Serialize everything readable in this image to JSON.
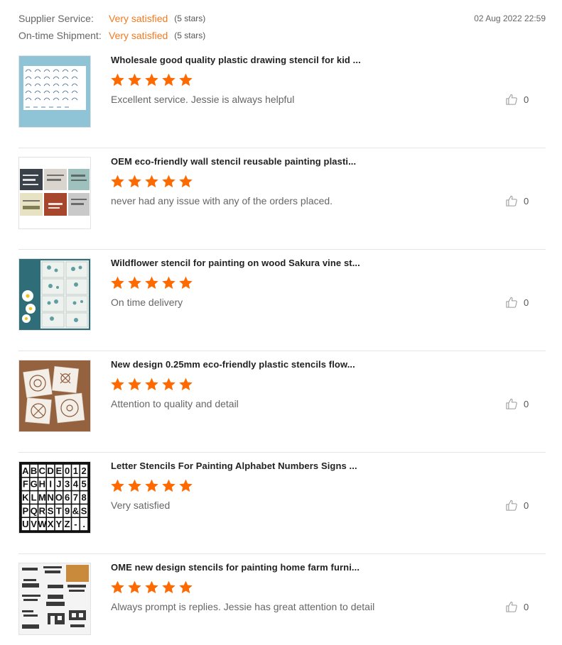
{
  "summary": {
    "supplier_service": {
      "label": "Supplier Service:",
      "value": "Very satisfied",
      "stars_note": "(5 stars)"
    },
    "ontime_shipment": {
      "label": "On-time Shipment:",
      "value": "Very satisfied",
      "stars_note": "(5 stars)"
    },
    "date": "02 Aug 2022 22:59"
  },
  "colors": {
    "accent": "#f47a1f",
    "star": "#ff6a00"
  },
  "icons": {
    "star": "star-icon",
    "like": "thumbs-up-icon"
  },
  "reviews": [
    {
      "title": "Wholesale good quality plastic drawing stencil for kid ...",
      "rating": 5,
      "comment": "Excellent service. Jessie is always helpful",
      "likes": "0"
    },
    {
      "title": "OEM eco-friendly wall stencil reusable painting plasti...",
      "rating": 5,
      "comment": "never had any issue with any of the orders placed.",
      "likes": "0"
    },
    {
      "title": "Wildflower stencil for painting on wood Sakura vine st...",
      "rating": 5,
      "comment": "On time delivery",
      "likes": "0"
    },
    {
      "title": "New design 0.25mm eco-friendly plastic stencils flow...",
      "rating": 5,
      "comment": "Attention to quality and detail",
      "likes": "0"
    },
    {
      "title": "Letter Stencils For Painting Alphabet Numbers Signs ...",
      "rating": 5,
      "comment": "Very satisfied",
      "likes": "0"
    },
    {
      "title": "OME new design stencils for painting home farm furni...",
      "rating": 5,
      "comment": "Always prompt is replies. Jessie has great attention to detail",
      "likes": "0"
    }
  ],
  "thumb5_chars": [
    "A",
    "B",
    "C",
    "D",
    "E",
    "0",
    "1",
    "2",
    "F",
    "G",
    "H",
    "I",
    "J",
    "3",
    "4",
    "5",
    "K",
    "L",
    "M",
    "N",
    "O",
    "6",
    "7",
    "8",
    "P",
    "Q",
    "R",
    "S",
    "T",
    "9",
    "&",
    "S",
    "U",
    "V",
    "W",
    "X",
    "Y",
    "Z",
    "-",
    "."
  ]
}
